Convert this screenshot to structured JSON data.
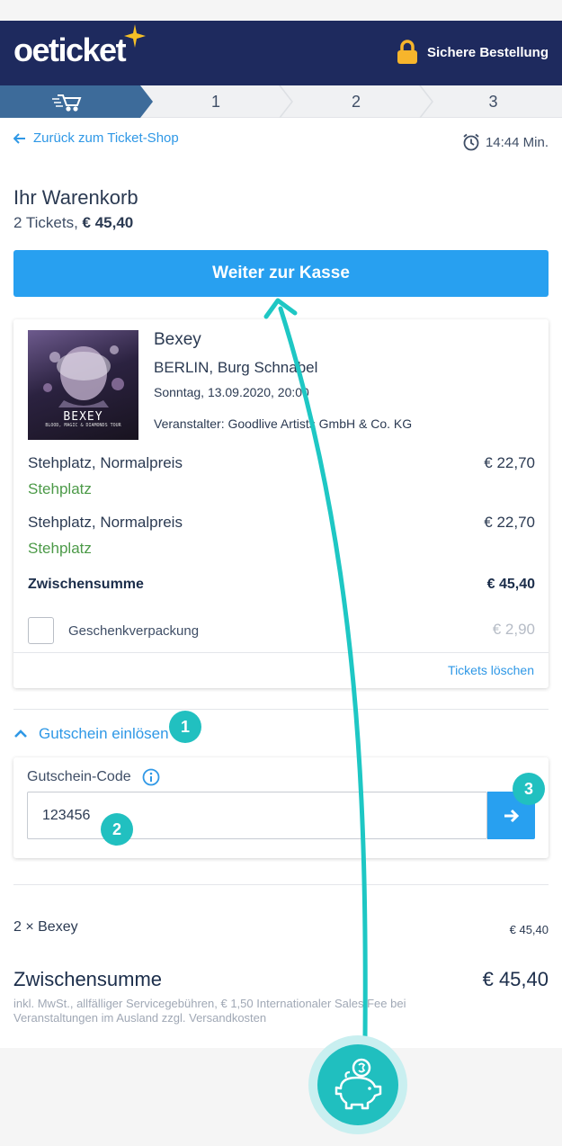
{
  "header": {
    "logo": "oeticket",
    "secure_label": "Sichere Bestellung"
  },
  "steps": [
    "1",
    "2",
    "3"
  ],
  "nav": {
    "back_label": "Zurück zum Ticket-Shop",
    "timer": "14:44 Min."
  },
  "cart": {
    "title": "Ihr Warenkorb",
    "count": "2 Tickets,",
    "total": "€ 45,40",
    "cta_label": "Weiter zur Kasse"
  },
  "event": {
    "poster_name": "BEXEY",
    "poster_tour": "BLOOD, MAGIC & DIAMONDS TOUR",
    "name": "Bexey",
    "venue": "BERLIN, Burg Schnabel",
    "date": "Sonntag, 13.09.2020, 20:00",
    "organizer": "Veranstalter: Goodlive Artists GmbH & Co. KG"
  },
  "tickets": [
    {
      "name": "Stehplatz, Normalpreis",
      "category": "Stehplatz",
      "price": "€ 22,70"
    },
    {
      "name": "Stehplatz, Normalpreis",
      "category": "Stehplatz",
      "price": "€ 22,70"
    }
  ],
  "card": {
    "subtotal_label": "Zwischensumme",
    "subtotal_value": "€ 45,40",
    "gift_label": "Geschenkverpackung",
    "gift_price": "€ 2,90",
    "delete_label": "Tickets löschen"
  },
  "voucher": {
    "toggle_label": "Gutschein einlösen",
    "field_label": "Gutschein-Code",
    "value": "123456"
  },
  "summary": {
    "item": "2 × Bexey",
    "item_price": "€ 45,40",
    "title": "Zwischensumme",
    "total": "€ 45,40",
    "note": "inkl. MwSt., allfälliger Servicegebühren, € 1,50 Internationaler Sales Fee bei Veranstaltungen im Ausland zzgl. Versandkosten"
  },
  "badges": [
    "1",
    "2",
    "3"
  ],
  "colors": {
    "header": "#1e2a5e",
    "accent": "#28a0f0",
    "link": "#2f98e6",
    "category": "#4c9a48",
    "annotation": "#21c0c0",
    "star": "#f6c026",
    "lock": "#f7b52c"
  }
}
